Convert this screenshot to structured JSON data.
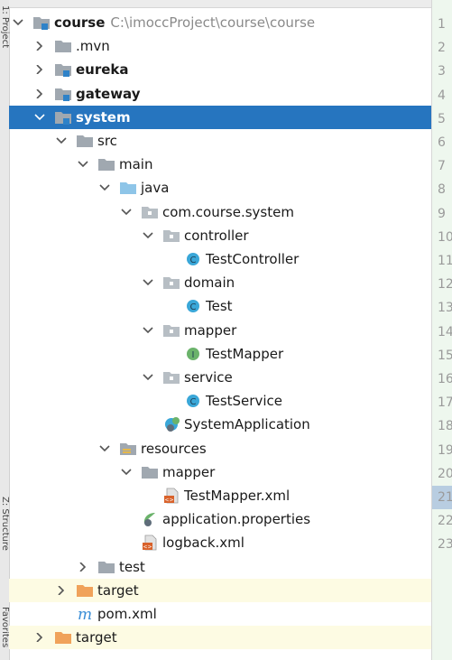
{
  "tool_window": {
    "title": "Project"
  },
  "sidebar": {
    "tabs": [
      "1: Project",
      "Z: Structure",
      "Favorites"
    ]
  },
  "tree": [
    {
      "label": "course",
      "bold": true,
      "path": "C:\\imoccProject\\course\\course",
      "depth": 0,
      "expand": "down",
      "icon": "module-folder-icon"
    },
    {
      "label": ".mvn",
      "depth": 1,
      "expand": "right",
      "icon": "folder-icon"
    },
    {
      "label": "eureka",
      "bold": true,
      "depth": 1,
      "expand": "right",
      "icon": "module-folder-icon"
    },
    {
      "label": "gateway",
      "bold": true,
      "depth": 1,
      "expand": "right",
      "icon": "module-folder-icon"
    },
    {
      "label": "system",
      "bold": true,
      "depth": 1,
      "expand": "down",
      "icon": "module-folder-icon",
      "selected": true
    },
    {
      "label": "src",
      "depth": 2,
      "expand": "down",
      "icon": "folder-icon"
    },
    {
      "label": "main",
      "depth": 3,
      "expand": "down",
      "icon": "folder-icon"
    },
    {
      "label": "java",
      "depth": 4,
      "expand": "down",
      "icon": "source-folder-icon"
    },
    {
      "label": "com.course.system",
      "depth": 5,
      "expand": "down",
      "icon": "package-icon"
    },
    {
      "label": "controller",
      "depth": 6,
      "expand": "down",
      "icon": "package-icon"
    },
    {
      "label": "TestController",
      "depth": 7,
      "icon": "class-icon"
    },
    {
      "label": "domain",
      "depth": 6,
      "expand": "down",
      "icon": "package-icon"
    },
    {
      "label": "Test",
      "depth": 7,
      "icon": "class-icon"
    },
    {
      "label": "mapper",
      "depth": 6,
      "expand": "down",
      "icon": "package-icon"
    },
    {
      "label": "TestMapper",
      "depth": 7,
      "icon": "interface-icon"
    },
    {
      "label": "service",
      "depth": 6,
      "expand": "down",
      "icon": "package-icon"
    },
    {
      "label": "TestService",
      "depth": 7,
      "icon": "class-icon"
    },
    {
      "label": "SystemApplication",
      "depth": 6,
      "icon": "spring-boot-class-icon"
    },
    {
      "label": "resources",
      "depth": 4,
      "expand": "down",
      "icon": "resources-folder-icon"
    },
    {
      "label": "mapper",
      "depth": 5,
      "expand": "down",
      "icon": "folder-icon"
    },
    {
      "label": "TestMapper.xml",
      "depth": 6,
      "icon": "xml-file-icon"
    },
    {
      "label": "application.properties",
      "depth": 5,
      "icon": "spring-properties-icon"
    },
    {
      "label": "logback.xml",
      "depth": 5,
      "icon": "xml-file-icon"
    },
    {
      "label": "test",
      "depth": 3,
      "expand": "right",
      "icon": "folder-icon"
    },
    {
      "label": "target",
      "depth": 2,
      "expand": "right",
      "icon": "excluded-folder-icon",
      "excluded": true
    },
    {
      "label": "pom.xml",
      "depth": 2,
      "icon": "maven-icon"
    },
    {
      "label": "target",
      "depth": 1,
      "expand": "right",
      "icon": "excluded-folder-icon",
      "excluded": true
    }
  ],
  "gutter": {
    "line_numbers": [
      "1",
      "2",
      "3",
      "4",
      "5",
      "6",
      "7",
      "8",
      "9",
      "10",
      "11",
      "12",
      "13",
      "14",
      "15",
      "16",
      "17",
      "18",
      "19",
      "20",
      "21",
      "22",
      "23"
    ],
    "highlighted": "21"
  },
  "colors": {
    "selection": "#2675bf",
    "excluded_row": "#fdfbe3",
    "folder": "#a0a8b0",
    "source_folder": "#8ec5e8",
    "excluded_folder": "#f0a25a",
    "class": "#3aa7d8",
    "interface": "#6bb36b",
    "module_marker": "#2f82c8"
  }
}
